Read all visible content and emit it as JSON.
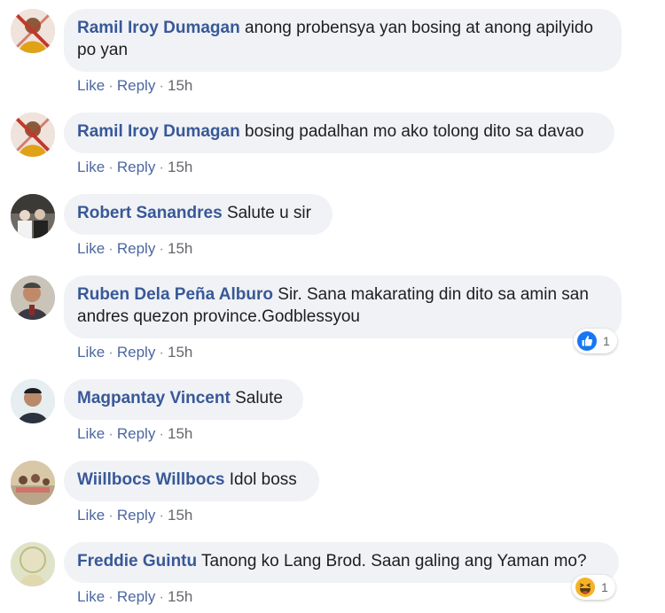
{
  "action_labels": {
    "like": "Like",
    "reply": "Reply",
    "separator": "·"
  },
  "colors": {
    "author": "#385898",
    "bubble": "#f0f2f5",
    "meta": "#65676b",
    "like_blue": "#1877f2"
  },
  "comments": [
    {
      "author": "Ramil Iroy Dumagan",
      "text": "anong probensya yan bosing at anong apilyido po yan",
      "time": "15h",
      "avatar": "avatar-photo"
    },
    {
      "author": "Ramil Iroy Dumagan",
      "text": "bosing padalhan mo ako tolong dito sa davao",
      "time": "15h",
      "avatar": "avatar-photo"
    },
    {
      "author": "Robert Sanandres",
      "text": "Salute u sir",
      "time": "15h",
      "avatar": "avatar-photo"
    },
    {
      "author": "Ruben Dela Peña Alburo",
      "text": "Sir. Sana makarating din dito sa amin san andres quezon province.Godblessyou",
      "time": "15h",
      "avatar": "avatar-photo",
      "reaction": {
        "icon": "like-reaction-icon",
        "count": "1"
      }
    },
    {
      "author": "Magpantay Vincent",
      "text": "Salute",
      "time": "15h",
      "avatar": "avatar-photo"
    },
    {
      "author": "Wiillbocs Willbocs",
      "text": "Idol boss",
      "time": "15h",
      "avatar": "avatar-photo"
    },
    {
      "author": "Freddie Guintu",
      "text": "Tanong ko Lang Brod. Saan galing ang Yaman mo?",
      "time": "15h",
      "avatar": "avatar-photo",
      "reaction": {
        "icon": "haha-reaction-icon",
        "count": "1"
      }
    }
  ]
}
